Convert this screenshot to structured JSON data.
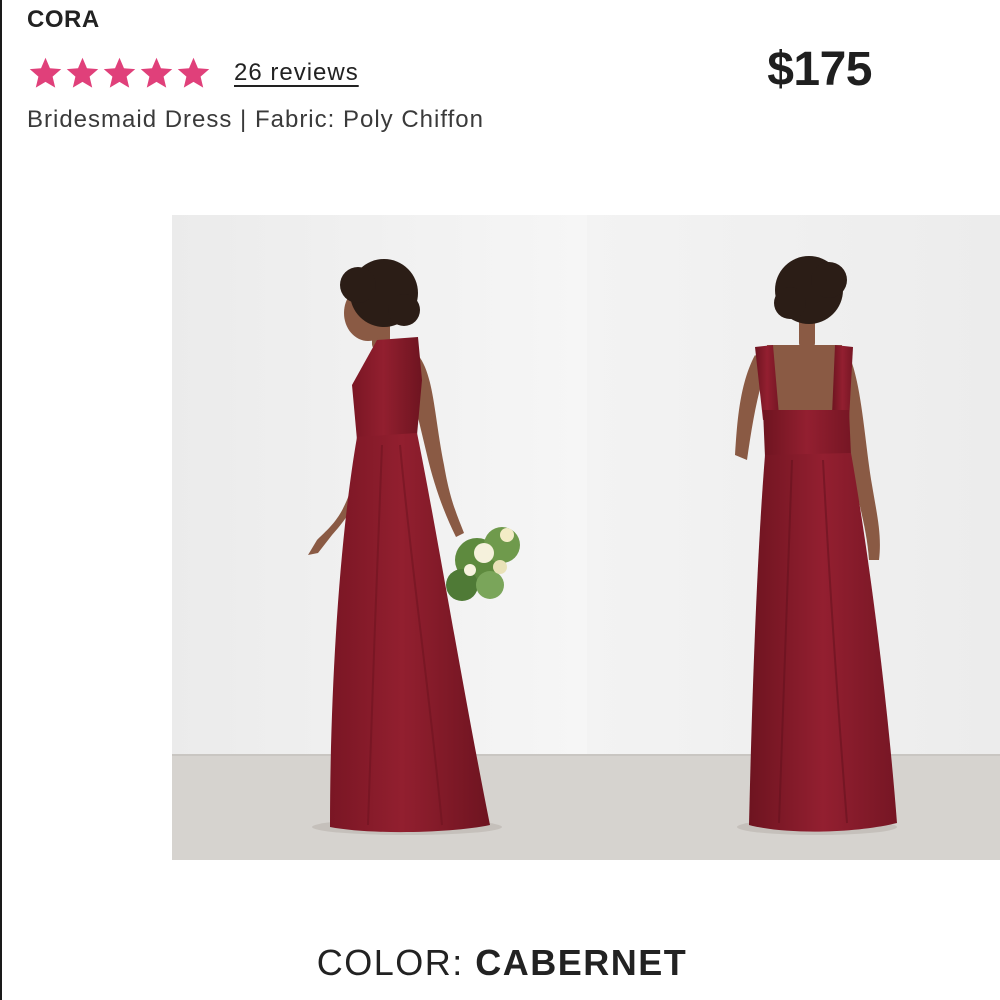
{
  "product": {
    "name": "CORA",
    "rating": 5,
    "max_rating": 5,
    "reviews_label": "26 reviews",
    "price": "$175",
    "subtitle": "Bridesmaid Dress | Fabric: Poly Chiffon"
  },
  "gallery": {
    "photos": [
      {
        "view": "front",
        "icon": "dress-front-photo"
      },
      {
        "view": "back",
        "icon": "dress-back-photo"
      }
    ]
  },
  "color": {
    "prefix": "COLOR: ",
    "value": "CABERNET"
  },
  "colors": {
    "star": "#e0407a",
    "dress": "#8c1d2c",
    "wall": "#f2f2f2",
    "floor": "#d6d3cf"
  }
}
